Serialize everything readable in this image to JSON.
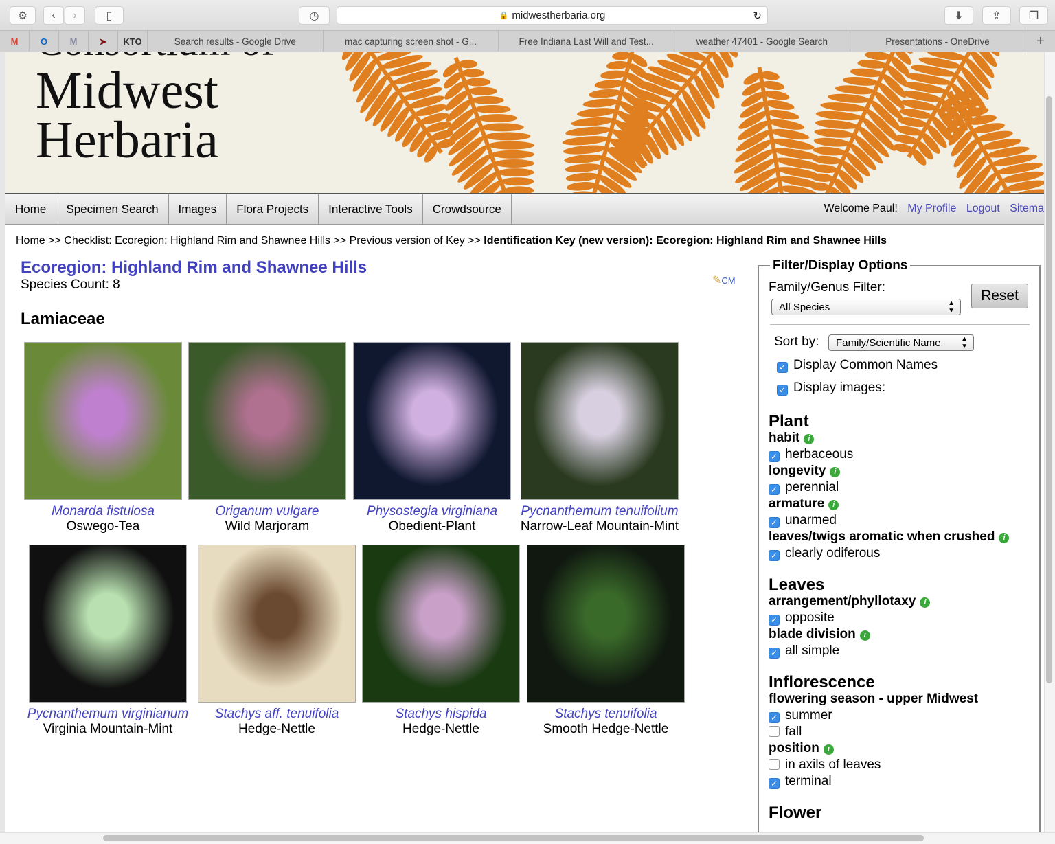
{
  "browser": {
    "url": "midwestherbaria.org",
    "pinned": [
      {
        "icon": "gmail-icon",
        "label": "M",
        "color": "#d44638"
      },
      {
        "icon": "outlook-icon",
        "label": "O",
        "color": "#0a64c8"
      },
      {
        "icon": "m-app-icon",
        "label": "M",
        "color": "#8a8aa0"
      },
      {
        "icon": "cursor-app-icon",
        "label": "➤",
        "color": "#7a1010"
      },
      {
        "icon": "kto-icon",
        "label": "KTO",
        "color": "#333"
      }
    ],
    "tabs": [
      "Search results - Google Drive",
      "mac capturing screen shot - G...",
      "Free Indiana Last Will and Test...",
      "weather 47401 - Google Search",
      "Presentations - OneDrive"
    ],
    "new_tab": "+"
  },
  "banner": {
    "logo_line1": "Consortium of",
    "logo_line2": "Midwest",
    "logo_line3": "Herbaria",
    "fern_color": "#e07f1f"
  },
  "nav": {
    "items": [
      "Home",
      "Specimen Search",
      "Images",
      "Flora Projects",
      "Interactive Tools",
      "Crowdsource"
    ],
    "welcome": "Welcome Paul!",
    "my_profile": "My Profile",
    "logout": "Logout",
    "sitemap": "Sitema"
  },
  "breadcrumb": {
    "parts": [
      "Home",
      ">>",
      "Checklist: Ecoregion: Highland Rim and Shawnee Hills",
      ">>",
      "Previous version of Key",
      ">>"
    ],
    "current": "Identification Key (new version): Ecoregion: Highland Rim and Shawnee Hills"
  },
  "main": {
    "title": "Ecoregion: Highland Rim and Shawnee Hills",
    "species_count": "Species Count: 8",
    "edit_label": "CM",
    "family": "Lamiaceae",
    "species": [
      {
        "sci": "Monarda fistulosa",
        "common": "Oswego-Tea",
        "tone": [
          "#6a8a3a",
          "#c080d0"
        ]
      },
      {
        "sci": "Origanum vulgare",
        "common": "Wild Marjoram",
        "tone": [
          "#3a5a2a",
          "#b07090"
        ]
      },
      {
        "sci": "Physostegia virginiana",
        "common": "Obedient-Plant",
        "tone": [
          "#101830",
          "#d0b0e0"
        ]
      },
      {
        "sci": "Pycnanthemum tenuifolium",
        "common": "Narrow-Leaf Mountain-Mint",
        "tone": [
          "#2a3a20",
          "#d8d0e0"
        ]
      },
      {
        "sci": "Pycnanthemum virginianum",
        "common": "Virginia Mountain-Mint",
        "tone": [
          "#101010",
          "#b8e0b0"
        ]
      },
      {
        "sci": "Stachys aff. tenuifolia",
        "common": "Hedge-Nettle",
        "tone": [
          "#e8dcc0",
          "#6a4a30"
        ]
      },
      {
        "sci": "Stachys hispida",
        "common": "Hedge-Nettle",
        "tone": [
          "#1a3a12",
          "#c8a0c8"
        ]
      },
      {
        "sci": "Stachys tenuifolia",
        "common": "Smooth Hedge-Nettle",
        "tone": [
          "#101810",
          "#3a6a2a"
        ]
      }
    ]
  },
  "panel": {
    "legend": "Filter/Display Options",
    "filter_label": "Family/Genus Filter:",
    "filter_value": "All Species",
    "reset": "Reset",
    "sort_label": "Sort by:",
    "sort_value": "Family/Scientific Name",
    "display_common": "Display Common Names",
    "display_images": "Display images:",
    "sections": [
      {
        "title": "Plant",
        "chars": [
          {
            "name": "habit",
            "opts": [
              {
                "label": "herbaceous",
                "checked": true
              }
            ]
          },
          {
            "name": "longevity",
            "opts": [
              {
                "label": "perennial",
                "checked": true
              }
            ]
          },
          {
            "name": "armature",
            "opts": [
              {
                "label": "unarmed",
                "checked": true
              }
            ]
          },
          {
            "name": "leaves/twigs aromatic when crushed",
            "opts": [
              {
                "label": "clearly odiferous",
                "checked": true
              }
            ]
          }
        ]
      },
      {
        "title": "Leaves",
        "chars": [
          {
            "name": "arrangement/phyllotaxy",
            "opts": [
              {
                "label": "opposite",
                "checked": true
              }
            ]
          },
          {
            "name": "blade division",
            "opts": [
              {
                "label": "all simple",
                "checked": true
              }
            ]
          }
        ]
      },
      {
        "title": "Inflorescence",
        "chars": [
          {
            "name": "flowering season - upper Midwest",
            "noinfo": true,
            "opts": [
              {
                "label": "summer",
                "checked": true
              },
              {
                "label": "fall",
                "checked": false
              }
            ]
          },
          {
            "name": "position",
            "opts": [
              {
                "label": "in axils of leaves",
                "checked": false
              },
              {
                "label": "terminal",
                "checked": true
              }
            ]
          }
        ]
      }
    ],
    "next_section": "Flower"
  }
}
